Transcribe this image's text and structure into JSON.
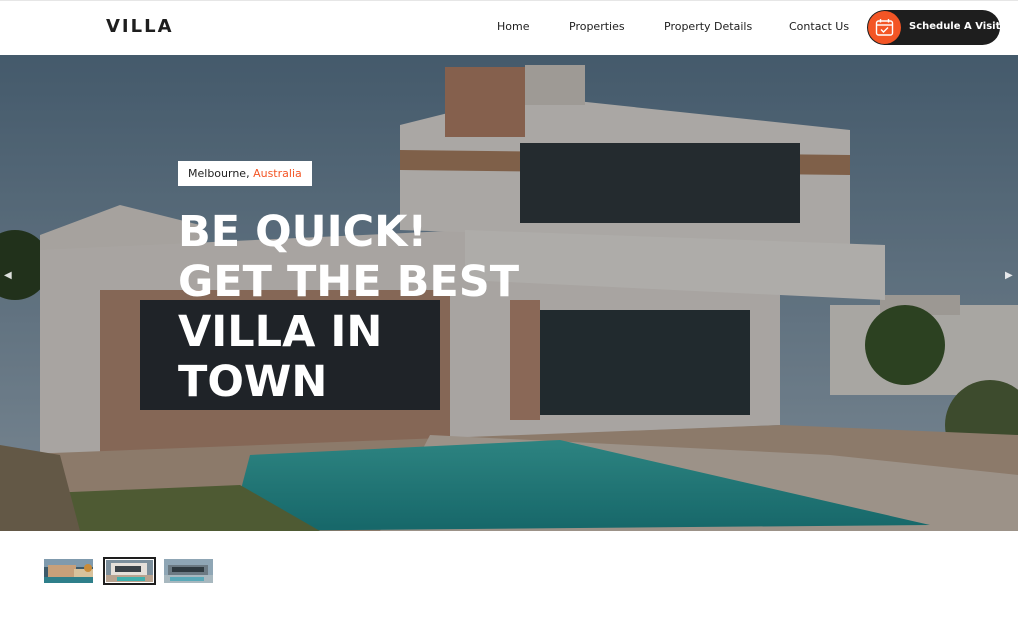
{
  "header": {
    "logo": "VILLA",
    "nav": {
      "home": "Home",
      "properties": "Properties",
      "property_details": "Property Details",
      "contact_us": "Contact Us"
    },
    "cta": {
      "label": "Schedule A Visit",
      "icon": "calendar-check-icon"
    }
  },
  "hero": {
    "location_city": "Melbourne,",
    "location_country": "Australia",
    "title_lines": [
      "BE QUICK!",
      "GET THE BEST",
      "VILLA IN",
      "TOWN"
    ],
    "prev_arrow": "◀",
    "next_arrow": "▶"
  },
  "thumbnails": {
    "count": 3,
    "active_index": 1
  },
  "colors": {
    "accent": "#f35525",
    "dark": "#1e1e1e",
    "white": "#ffffff"
  }
}
